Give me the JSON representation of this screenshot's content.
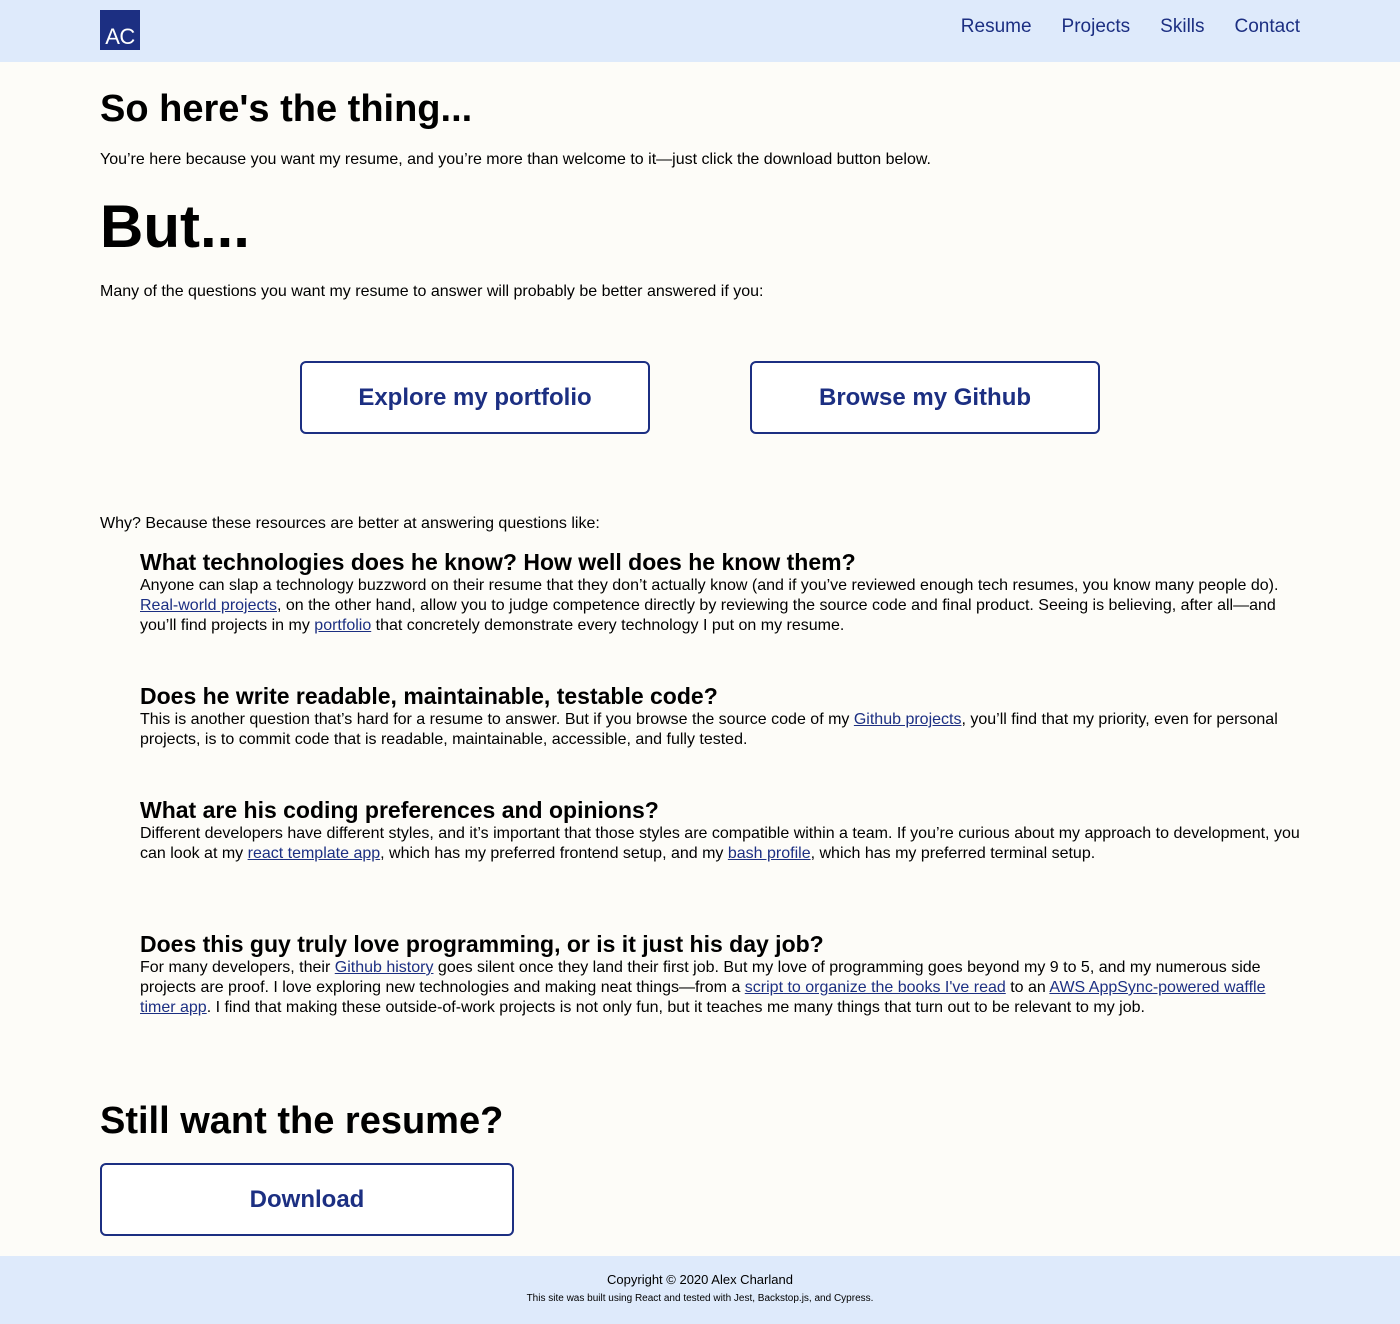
{
  "header": {
    "logo_text": "AC",
    "nav": [
      "Resume",
      "Projects",
      "Skills",
      "Contact"
    ]
  },
  "intro": {
    "heading": "So here's the thing...",
    "text": "You’re here because you want my resume, and you’re more than welcome to it—just click the download button below."
  },
  "but": {
    "heading": "But...",
    "text": "Many of the questions you want my resume to answer will probably be better answered if you:"
  },
  "buttons": {
    "portfolio": "Explore my portfolio",
    "github": "Browse my Github"
  },
  "why": "Why? Because these resources are better at answering questions like:",
  "questions": [
    {
      "title": "What technologies does he know? How well does he know them?",
      "parts": [
        {
          "t": "Anyone can slap a technology buzzword on their resume that they don’t actually know (and if you’ve reviewed enough tech resumes, you know many people do). "
        },
        {
          "t": "Real-world projects",
          "link": true
        },
        {
          "t": ", on the other hand, allow you to judge competence directly by reviewing the source code and final product. Seeing is believing, after all—and you’ll find projects in my "
        },
        {
          "t": "portfolio",
          "link": true
        },
        {
          "t": " that concretely demonstrate every technology I put on my resume."
        }
      ]
    },
    {
      "title": "Does he write readable, maintainable, testable code?",
      "parts": [
        {
          "t": "This is another question that’s hard for a resume to answer. But if you browse the source code of my "
        },
        {
          "t": "Github projects",
          "link": true
        },
        {
          "t": ", you’ll find that my priority, even for personal projects, is to commit code that is readable, maintainable, accessible, and fully tested."
        }
      ]
    },
    {
      "title": "What are his coding preferences and opinions?",
      "parts": [
        {
          "t": "Different developers have different styles, and it’s important that those styles are compatible within a team. If you’re curious about my approach to development, you can look at my "
        },
        {
          "t": "react template app",
          "link": true
        },
        {
          "t": ", which has my preferred frontend setup, and my "
        },
        {
          "t": "bash profile",
          "link": true
        },
        {
          "t": ", which has my preferred terminal setup."
        }
      ]
    },
    {
      "title": "Does this guy truly love programming, or is it just his day job?",
      "parts": [
        {
          "t": "For many developers, their "
        },
        {
          "t": "Github history",
          "link": true
        },
        {
          "t": " goes silent once they land their first job. But my love of programming goes beyond my 9 to 5, and my numerous side projects are proof. I love exploring new technologies and making neat things—from a "
        },
        {
          "t": "script to organize the books I've read",
          "link": true
        },
        {
          "t": " to an "
        },
        {
          "t": "AWS AppSync-powered waffle timer app",
          "link": true
        },
        {
          "t": ". I find that making these outside-of-work projects is not only fun, but it teaches me many things that turn out to be relevant to my job."
        }
      ]
    }
  ],
  "still": {
    "heading": "Still want the resume?",
    "download": "Download"
  },
  "footer": {
    "copyright": "Copyright © 2020 Alex Charland",
    "built": "This site was built using React and tested with Jest, Backstop.js, and Cypress."
  }
}
